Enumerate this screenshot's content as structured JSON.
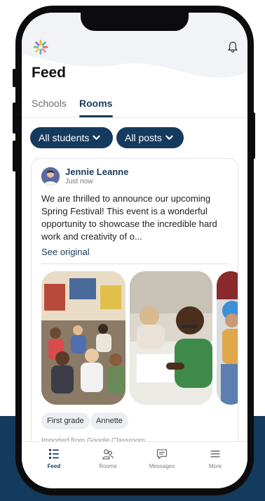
{
  "header": {
    "title": "Feed",
    "logo_icon": "sparkle-logo-icon",
    "notification_icon": "bell-icon"
  },
  "tabs": [
    {
      "label": "Schools",
      "active": false
    },
    {
      "label": "Rooms",
      "active": true
    }
  ],
  "filters": {
    "students_label": "All students",
    "posts_label": "All posts"
  },
  "post": {
    "author": "Jennie Leanne",
    "timestamp": "Just now",
    "body": "We are thrilled to announce our upcoming Spring Festival! This event is a wonderful opportunity to showcase the incredible hard work and creativity of o...",
    "see_original": "See original",
    "tags": [
      "First grade",
      "Annette"
    ],
    "source": "Imported from Google Classroom"
  },
  "nav": {
    "items": [
      {
        "label": "Feed",
        "icon": "feed-list-icon",
        "active": true
      },
      {
        "label": "Rooms",
        "icon": "rooms-people-icon",
        "active": false
      },
      {
        "label": "Messages",
        "icon": "messages-icon",
        "active": false
      },
      {
        "label": "More",
        "icon": "menu-icon",
        "active": false
      }
    ]
  },
  "colors": {
    "brand_navy": "#143a5e",
    "accent_text": "#1b3b5d",
    "chip_bg": "#eceef1"
  }
}
